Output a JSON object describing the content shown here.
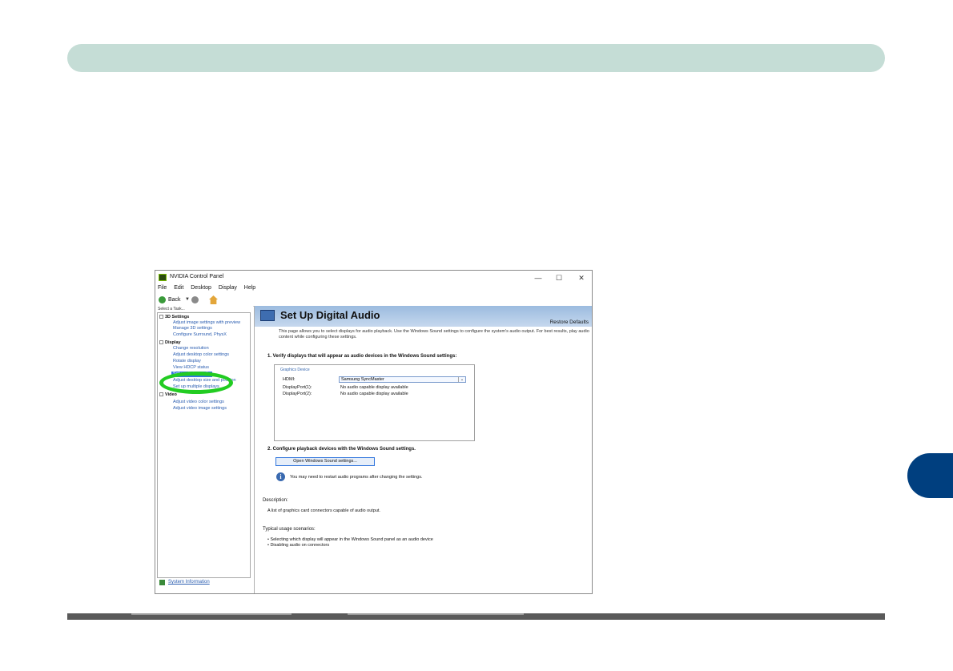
{
  "window": {
    "title": "NVIDIA Control Panel",
    "controls": {
      "minimize": "—",
      "maximize": "☐",
      "close": "✕"
    }
  },
  "menu": [
    "File",
    "Edit",
    "Desktop",
    "Display",
    "Help"
  ],
  "toolbar": {
    "back_label": "Back"
  },
  "sidebar": {
    "task_label": "Select a Task...",
    "items": [
      {
        "label": "3D Settings",
        "kind": "category"
      },
      {
        "label": "Adjust image settings with preview",
        "kind": "link"
      },
      {
        "label": "Manage 3D settings",
        "kind": "link"
      },
      {
        "label": "Configure Surround, PhysX",
        "kind": "link"
      },
      {
        "label": "Display",
        "kind": "category"
      },
      {
        "label": "Change resolution",
        "kind": "link"
      },
      {
        "label": "Adjust desktop color settings",
        "kind": "link"
      },
      {
        "label": "Rotate display",
        "kind": "link"
      },
      {
        "label": "View HDCP status",
        "kind": "link"
      },
      {
        "label": "Set up digital audio",
        "kind": "selected"
      },
      {
        "label": "Adjust desktop size and position",
        "kind": "link"
      },
      {
        "label": "Set up multiple displays",
        "kind": "link"
      },
      {
        "label": "Video",
        "kind": "category"
      },
      {
        "label": "Adjust video color settings",
        "kind": "link"
      },
      {
        "label": "Adjust video image settings",
        "kind": "link"
      }
    ],
    "system_info": "System Information"
  },
  "page": {
    "title": "Set Up Digital Audio",
    "restore_defaults": "Restore Defaults",
    "intro": "This page allows you to select displays for audio playback. Use the Windows Sound settings to configure the system's audio output. For best results, play audio content while configuring these settings.",
    "section1": "1. Verify displays that will appear as audio devices in the Windows Sound settings:",
    "device_legend": "Graphics Device",
    "ports": [
      {
        "name": "HDMI:",
        "value": "Samsung SyncMaster"
      },
      {
        "name": "DisplayPort(1):",
        "value": "No audio capable display available"
      },
      {
        "name": "DisplayPort(2):",
        "value": "No audio capable display available"
      }
    ],
    "section2": "2. Configure playback devices with the Windows Sound settings.",
    "sound_button": "Open Windows Sound settings...",
    "info_note": "You may need to restart audio programs after changing the settings.",
    "description_label": "Description:",
    "description_text": "A list of graphics card connectors capable of audio output.",
    "usage_label": "Typical usage scenarios:",
    "usage_items": [
      "• Selecting which display will appear in the Windows Sound panel as an audio device",
      "• Disabling audio on connectors"
    ]
  },
  "colors": {
    "header_bar": "#c5ddd6",
    "chapter_tab": "#003f7f",
    "highlight_ring": "#22cc22",
    "selection": "#3377dd"
  }
}
